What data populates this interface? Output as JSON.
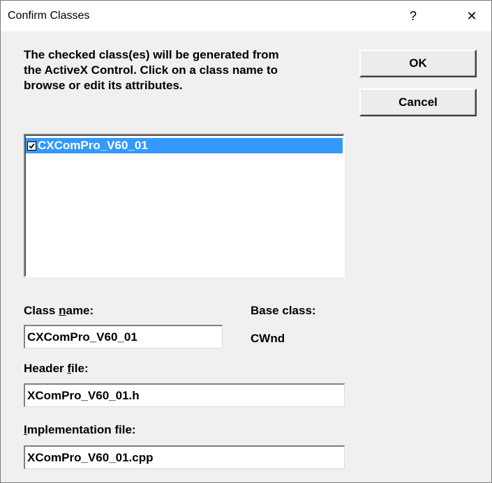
{
  "window": {
    "title": "Confirm Classes",
    "help_glyph": "?",
    "close_glyph": "✕"
  },
  "description": "The checked class(es) will be generated from\nthe ActiveX Control.  Click on a class name to\nbrowse or edit its attributes.",
  "buttons": {
    "ok": "OK",
    "cancel": "Cancel"
  },
  "class_list": {
    "items": [
      {
        "label": "CXComPro_V60_01",
        "checked": true,
        "selected": true
      }
    ]
  },
  "class_name": {
    "label_prefix": "Class ",
    "label_mnemonic": "n",
    "label_suffix": "ame:",
    "value": "CXComPro_V60_01"
  },
  "base_class": {
    "label": "Base class:",
    "value": "CWnd"
  },
  "header_file": {
    "label_prefix": "Header ",
    "label_mnemonic": "f",
    "label_suffix": "ile:",
    "value": "XComPro_V60_01.h"
  },
  "implementation_file": {
    "label_prefix": "",
    "label_mnemonic": "I",
    "label_suffix": "mplementation file:",
    "value": "XComPro_V60_01.cpp"
  },
  "colors": {
    "selection": "#3399ff",
    "dialog_bg": "#f0f0f0"
  }
}
